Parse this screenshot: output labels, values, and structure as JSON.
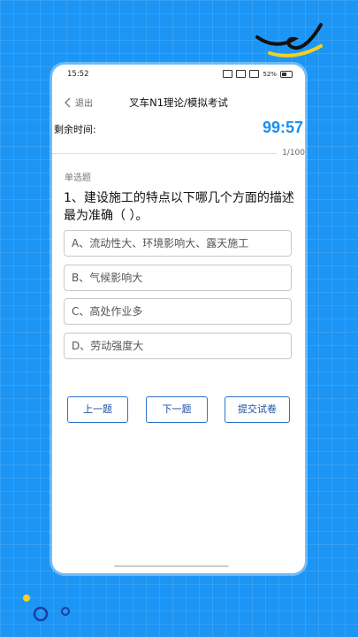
{
  "status_bar": {
    "time": "15:52",
    "indicators": "52%"
  },
  "nav": {
    "back_label": "退出",
    "title": "叉车N1理论/模拟考试"
  },
  "timer": {
    "label": "剩余时间:",
    "value": "99:57"
  },
  "progress": {
    "text": "1/100"
  },
  "question": {
    "type": "单选题",
    "text": "1、建设施工的特点以下哪几个方面的描述最为准确（ ）。",
    "options": [
      {
        "label": "A、流动性大、环境影响大、露天施工"
      },
      {
        "label": "B、气候影响大"
      },
      {
        "label": "C、高处作业多"
      },
      {
        "label": "D、劳动强度大"
      }
    ]
  },
  "buttons": {
    "prev": "上一题",
    "next": "下一题",
    "submit": "提交试卷"
  },
  "colors": {
    "background": "#1c95f5",
    "timer": "#1b8ff0",
    "button_border": "#2f72cc"
  }
}
